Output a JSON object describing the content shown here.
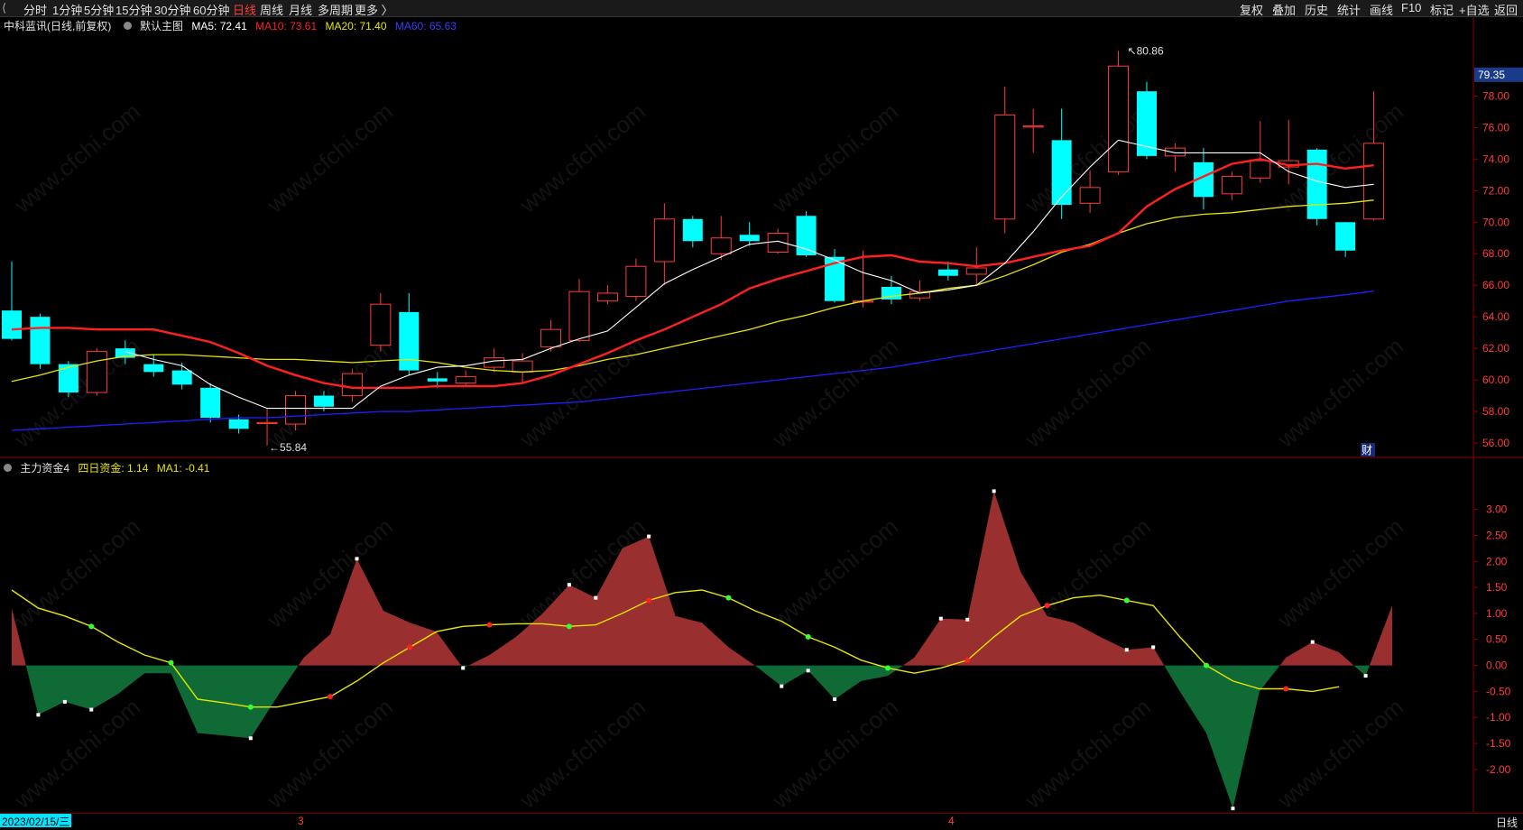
{
  "topbar": {
    "back_icon": "back-icon",
    "tabs": [
      "分时",
      "1分钟",
      "5分钟",
      "15分钟",
      "30分钟",
      "60分钟",
      "日线",
      "周线",
      "月线",
      "多周期",
      "更多 〉"
    ],
    "active_tab": "日线",
    "right_buttons": [
      "复权",
      "叠加",
      "历史",
      "统计",
      "画线",
      "F10",
      "标记",
      "+自选",
      "返回"
    ]
  },
  "infobar": {
    "stock": "中科蓝讯(日线,前复权)",
    "main_chart": "默认主图",
    "ma5": "MA5: 72.41",
    "ma10": "MA10: 73.61",
    "ma20": "MA20: 71.40",
    "ma60": "MA60: 65.63"
  },
  "subinfo": {
    "indicator": "主力资金4",
    "four_day": "四日资金: 1.14",
    "ma1": "MA1: -0.41"
  },
  "bottombar": {
    "date": "2023/02/15/三",
    "month_marks": [
      "3",
      "4"
    ],
    "period": "日线"
  },
  "colors": {
    "up": "#ff3b3b",
    "down": "#00ffff",
    "ma5": "#ffffff",
    "ma10": "#ff2020",
    "ma20": "#e6e600",
    "ma60": "#2020ff",
    "pos_area": "#9a2f2f",
    "neg_area": "#0f6a35",
    "ma1_line": "#e6e600"
  },
  "watermark": "www.cfchi.com",
  "chart_data": [
    {
      "type": "candlestick",
      "current_price_label": "79.35",
      "high_annotation": "80.86",
      "low_annotation": "55.84",
      "badge": "财",
      "y_ticks": [
        "78.00",
        "76.00",
        "74.00",
        "72.00",
        "70.00",
        "68.00",
        "66.00",
        "64.00",
        "62.00",
        "60.00",
        "58.00",
        "56.00"
      ],
      "ylim": [
        55.2,
        81.8
      ],
      "candles": [
        [
          64.4,
          62.6,
          67.5,
          62.5
        ],
        [
          64.0,
          61.0,
          64.2,
          60.7
        ],
        [
          61.0,
          59.2,
          61.2,
          58.9
        ],
        [
          59.2,
          61.8,
          62.0,
          59.0
        ],
        [
          62.0,
          61.4,
          62.5,
          61.0
        ],
        [
          61.0,
          60.5,
          61.6,
          60.2
        ],
        [
          60.6,
          59.7,
          61.1,
          59.4
        ],
        [
          59.5,
          57.6,
          59.8,
          57.3
        ],
        [
          57.5,
          56.9,
          57.8,
          56.6
        ],
        [
          57.3,
          57.3,
          58.2,
          55.84
        ],
        [
          57.2,
          59.0,
          59.3,
          56.8
        ],
        [
          59.0,
          58.3,
          59.3,
          58.0
        ],
        [
          59.0,
          60.4,
          60.7,
          58.6
        ],
        [
          62.2,
          64.8,
          65.5,
          61.8
        ],
        [
          64.3,
          60.6,
          65.5,
          60.3
        ],
        [
          60.1,
          59.9,
          60.5,
          59.5
        ],
        [
          59.8,
          60.2,
          60.6,
          59.6
        ],
        [
          60.8,
          61.4,
          62.0,
          60.5
        ],
        [
          60.5,
          61.2,
          61.7,
          59.8
        ],
        [
          62.1,
          63.2,
          63.8,
          61.8
        ],
        [
          62.5,
          65.6,
          66.4,
          62.4
        ],
        [
          65.0,
          65.5,
          66.0,
          64.8
        ],
        [
          65.3,
          67.2,
          67.7,
          65.0
        ],
        [
          67.5,
          70.2,
          71.2,
          66.0
        ],
        [
          70.2,
          68.8,
          70.4,
          68.4
        ],
        [
          68.0,
          69.0,
          70.4,
          67.6
        ],
        [
          69.2,
          68.8,
          70.0,
          68.5
        ],
        [
          68.1,
          69.3,
          69.6,
          68.0
        ],
        [
          70.4,
          67.9,
          70.7,
          67.8
        ],
        [
          67.8,
          65.0,
          68.3,
          64.9
        ],
        [
          65.0,
          65.0,
          68.2,
          64.6
        ],
        [
          65.9,
          65.1,
          66.6,
          64.8
        ],
        [
          65.2,
          65.6,
          66.3,
          65.0
        ],
        [
          67.0,
          66.6,
          67.5,
          66.3
        ],
        [
          66.7,
          67.1,
          68.4,
          66.0
        ],
        [
          70.2,
          76.8,
          78.6,
          69.3
        ],
        [
          76.1,
          76.1,
          77.2,
          74.4
        ],
        [
          75.2,
          71.1,
          77.2,
          70.2
        ],
        [
          71.2,
          72.2,
          73.3,
          70.6
        ],
        [
          73.2,
          79.9,
          80.86,
          73.0
        ],
        [
          78.3,
          74.2,
          78.9,
          74.0
        ],
        [
          74.2,
          74.7,
          75.0,
          73.2
        ],
        [
          73.8,
          71.6,
          74.7,
          70.8
        ],
        [
          71.8,
          72.9,
          73.2,
          71.4
        ],
        [
          72.8,
          73.9,
          76.4,
          72.5
        ],
        [
          73.5,
          73.9,
          76.5,
          72.4
        ],
        [
          74.6,
          70.2,
          74.7,
          69.8
        ],
        [
          70.0,
          68.2,
          70.0,
          67.8
        ],
        [
          70.2,
          75.0,
          78.3,
          70.1
        ]
      ],
      "ma5": [
        null,
        null,
        null,
        null,
        61.8,
        61.3,
        60.9,
        59.7,
        58.9,
        58.2,
        58.2,
        58.2,
        58.2,
        59.6,
        60.3,
        60.8,
        60.9,
        61.2,
        61.3,
        62.0,
        62.6,
        63.1,
        64.6,
        66.1,
        67.0,
        67.8,
        68.6,
        68.8,
        68.3,
        67.6,
        66.8,
        66.3,
        65.5,
        65.7,
        66.0,
        67.4,
        69.4,
        71.6,
        73.5,
        75.2,
        74.8,
        74.4,
        74.4,
        74.4,
        74.4,
        73.2,
        72.6,
        72.2,
        72.4
      ],
      "ma10": [
        63.2,
        63.3,
        63.3,
        63.2,
        63.2,
        63.2,
        62.8,
        62.4,
        61.7,
        60.9,
        60.3,
        59.8,
        59.5,
        59.5,
        59.5,
        59.6,
        59.6,
        59.6,
        59.8,
        60.3,
        61.0,
        61.7,
        62.5,
        63.2,
        64.0,
        64.8,
        65.8,
        66.4,
        66.9,
        67.4,
        67.8,
        67.9,
        67.5,
        67.4,
        67.2,
        67.4,
        67.8,
        68.2,
        68.5,
        69.3,
        71.0,
        72.1,
        72.9,
        73.7,
        74.0,
        73.6,
        73.7,
        73.4,
        73.61
      ],
      "ma20": [
        59.9,
        60.3,
        60.8,
        61.2,
        61.5,
        61.6,
        61.6,
        61.5,
        61.4,
        61.3,
        61.3,
        61.2,
        61.1,
        61.2,
        61.3,
        61.1,
        60.8,
        60.6,
        60.5,
        60.6,
        60.9,
        61.3,
        61.6,
        62.0,
        62.4,
        62.8,
        63.2,
        63.7,
        64.1,
        64.6,
        65.0,
        65.3,
        65.5,
        65.8,
        66.0,
        66.6,
        67.3,
        68.1,
        68.6,
        69.3,
        69.9,
        70.3,
        70.5,
        70.6,
        70.8,
        71.0,
        71.1,
        71.2,
        71.4
      ],
      "ma60": [
        56.8,
        56.9,
        57.0,
        57.1,
        57.2,
        57.3,
        57.4,
        57.5,
        57.6,
        57.6,
        57.7,
        57.8,
        57.9,
        58.0,
        58.0,
        58.1,
        58.2,
        58.3,
        58.4,
        58.5,
        58.6,
        58.8,
        59.0,
        59.2,
        59.4,
        59.6,
        59.8,
        60.0,
        60.2,
        60.4,
        60.6,
        60.8,
        61.1,
        61.4,
        61.7,
        62.0,
        62.3,
        62.6,
        62.9,
        63.2,
        63.5,
        63.8,
        64.1,
        64.4,
        64.7,
        65.0,
        65.2,
        65.4,
        65.63
      ]
    },
    {
      "type": "area",
      "title": "主力资金4",
      "y_ticks": [
        "3.00",
        "2.50",
        "2.00",
        "1.50",
        "1.00",
        "0.50",
        "0.00",
        "-0.50",
        "-1.00",
        "-1.50",
        "-2.00"
      ],
      "ylim": [
        -2.8,
        3.6
      ],
      "series": [
        {
          "name": "四日资金",
          "values": [
            1.1,
            -0.95,
            -0.7,
            -0.85,
            -0.55,
            -0.15,
            -0.15,
            -1.3,
            -1.35,
            -1.4,
            -0.6,
            0.15,
            0.6,
            2.05,
            1.05,
            0.82,
            0.65,
            -0.05,
            0.2,
            0.55,
            1.0,
            1.55,
            1.3,
            2.25,
            2.48,
            0.95,
            0.82,
            0.35,
            0.0,
            -0.4,
            -0.1,
            -0.65,
            -0.3,
            -0.2,
            0.15,
            0.9,
            0.88,
            3.35,
            1.8,
            0.95,
            0.82,
            0.55,
            0.3,
            0.35,
            -0.5,
            -1.3,
            -2.75,
            -0.5,
            0.15,
            0.45,
            0.25,
            -0.2,
            1.15
          ]
        },
        {
          "name": "MA1",
          "values": [
            1.45,
            1.1,
            0.95,
            0.75,
            0.45,
            0.2,
            0.05,
            -0.65,
            -0.72,
            -0.8,
            -0.8,
            -0.7,
            -0.6,
            -0.3,
            0.05,
            0.35,
            0.65,
            0.75,
            0.78,
            0.8,
            0.8,
            0.75,
            0.78,
            1.0,
            1.25,
            1.4,
            1.45,
            1.3,
            1.05,
            0.85,
            0.55,
            0.35,
            0.1,
            -0.05,
            -0.15,
            -0.05,
            0.1,
            0.55,
            0.95,
            1.15,
            1.3,
            1.35,
            1.25,
            1.15,
            0.55,
            0.0,
            -0.3,
            -0.45,
            -0.45,
            -0.5,
            -0.41
          ]
        }
      ]
    }
  ]
}
